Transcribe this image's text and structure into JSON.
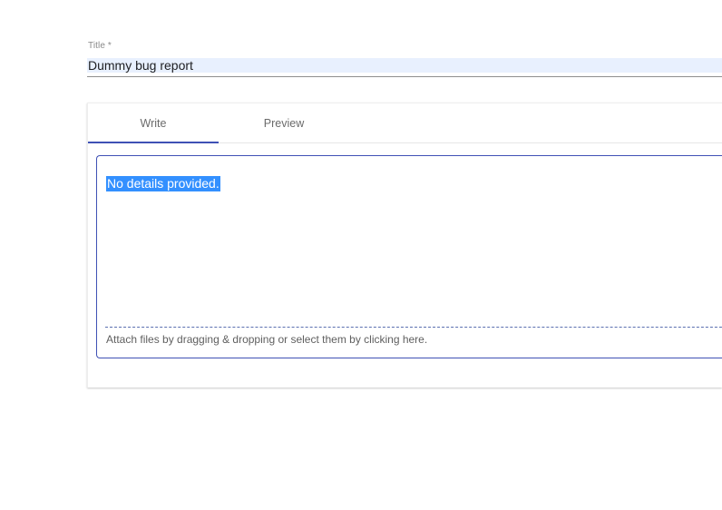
{
  "title_field": {
    "label": "Title *",
    "value": "Dummy bug report"
  },
  "editor": {
    "tabs": [
      {
        "label": "Write",
        "active": true
      },
      {
        "label": "Preview",
        "active": false
      }
    ],
    "body_text": "No details provided.",
    "attach_hint": "Attach files by dragging & dropping or select them by clicking here."
  },
  "colors": {
    "accent": "#3f51b5",
    "selection": "#3390ff",
    "autofill_bg": "#e8f0fe"
  }
}
